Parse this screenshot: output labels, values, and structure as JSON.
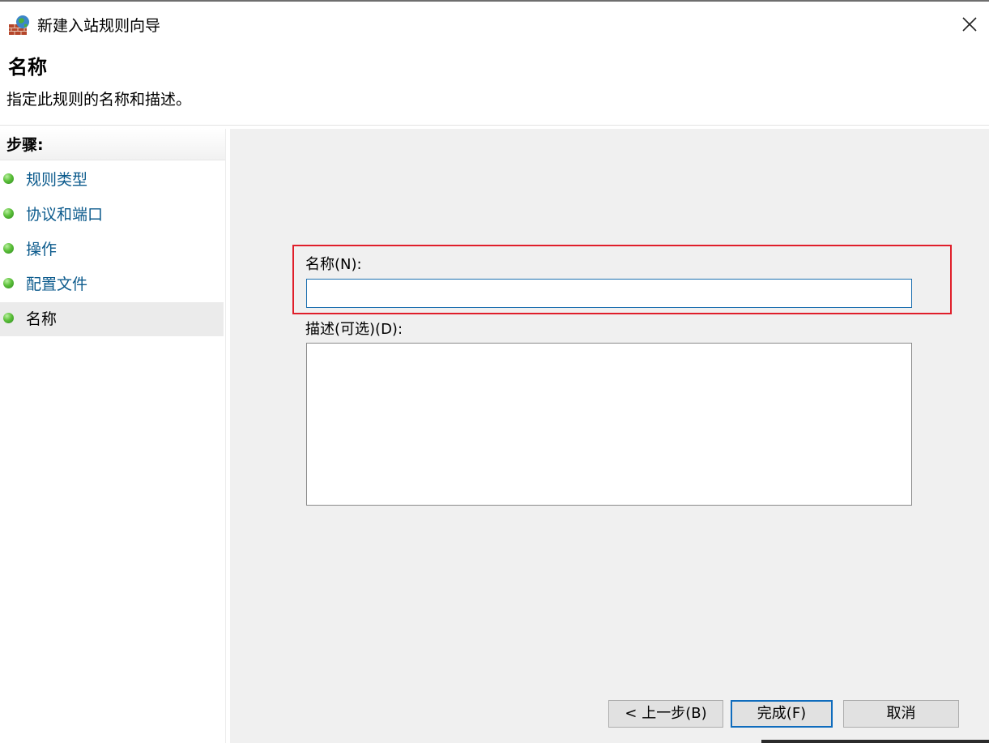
{
  "window": {
    "title": "新建入站规则向导",
    "icon": "firewall-globe-icon",
    "close_icon": "close-icon"
  },
  "header": {
    "title": "名称",
    "subtitle": "指定此规则的名称和描述。"
  },
  "sidebar": {
    "steps_label": "步骤:",
    "steps": [
      {
        "label": "规则类型",
        "current": false
      },
      {
        "label": "协议和端口",
        "current": false
      },
      {
        "label": "操作",
        "current": false
      },
      {
        "label": "配置文件",
        "current": false
      },
      {
        "label": "名称",
        "current": true
      }
    ]
  },
  "form": {
    "name_label": "名称(N):",
    "name_value": "",
    "description_label": "描述(可选)(D):",
    "description_value": ""
  },
  "buttons": {
    "back": "< 上一步(B)",
    "finish": "完成(F)",
    "cancel": "取消"
  },
  "colors": {
    "highlight": "#e01e2a",
    "link": "#0b5a8c",
    "focus_border": "#1c6fb0",
    "content_bg": "#f0f0f0"
  }
}
